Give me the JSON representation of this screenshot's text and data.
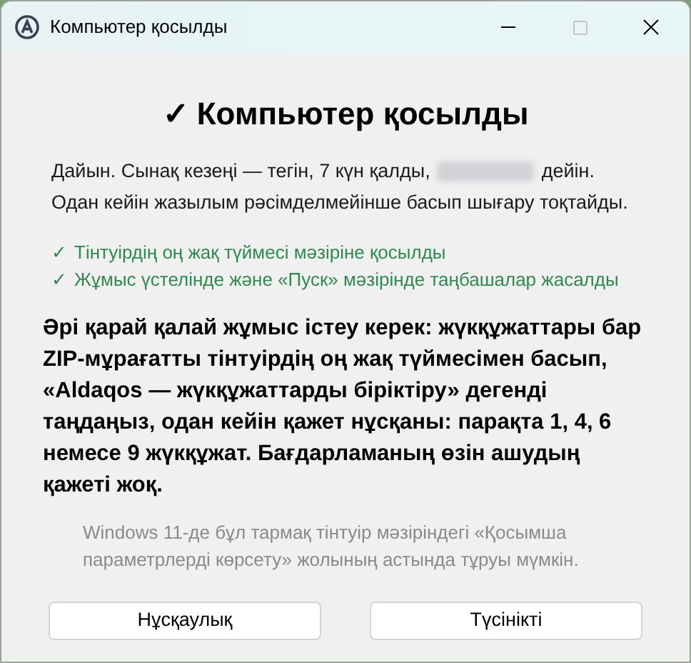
{
  "window": {
    "title": "Компьютер қосылды"
  },
  "heading": "✓ Компьютер қосылды",
  "status": {
    "before": "Дайын. Сынақ кезеңі — тегін, 7 күн қалды,",
    "after": "дейін.",
    "second_line": "Одан кейін жазылым рәсімделмейінше басып шығару тоқтайды."
  },
  "checks": [
    {
      "mark": "✓",
      "text": "Тінтуірдің оң жақ түймесі мәзіріне қосылды",
      "done": true
    },
    {
      "mark": "✓",
      "text": "Жұмыс үстелінде және «Пуск» мәзірінде таңбашалар жасалды",
      "done": true
    }
  ],
  "instructions": "Әрі қарай қалай жұмыс істеу керек: жүкқұжаттары бар ZIP-мұрағатты тінтуірдің оң жақ түймесімен басып, «Aldaqos — жүкқұжаттарды біріктіру» дегенді таңдаңыз, одан кейін қажет нұсқаны: парақта 1, 4, 6 немесе 9 жүкқұжат. Бағдарламаның өзін ашудың қажеті жоқ.",
  "note": "Windows 11-де бұл тармақ тінтуір мәзіріндегі «Қосымша параметрлерді көрсету» жолының астында тұруы мүмкін.",
  "buttons": [
    "Нұсқаулық",
    "Түсінікті"
  ]
}
